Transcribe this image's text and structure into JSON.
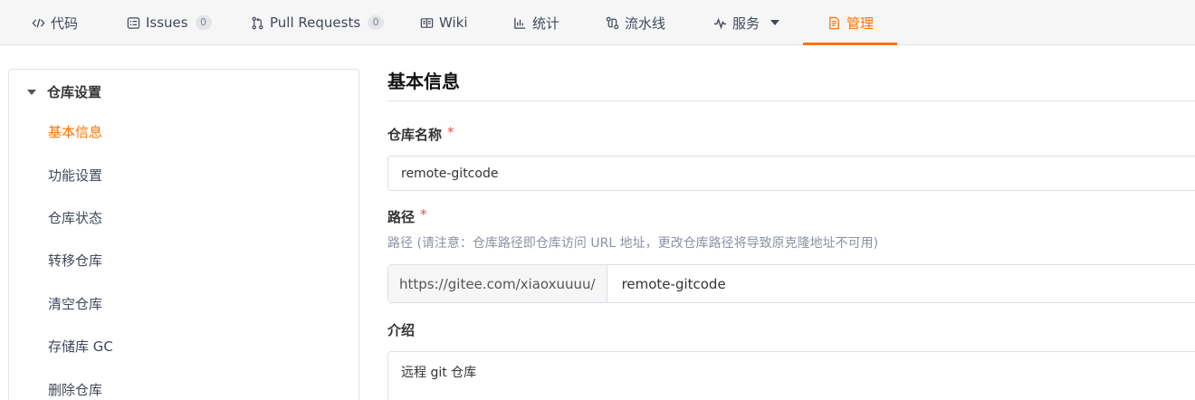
{
  "tabs": [
    {
      "label": "代码",
      "icon": "code-icon"
    },
    {
      "label": "Issues",
      "icon": "issues-icon",
      "count": "0"
    },
    {
      "label": "Pull Requests",
      "icon": "pull-request-icon",
      "count": "0"
    },
    {
      "label": "Wiki",
      "icon": "wiki-icon"
    },
    {
      "label": "统计",
      "icon": "chart-icon"
    },
    {
      "label": "流水线",
      "icon": "pipeline-icon"
    },
    {
      "label": "服务",
      "icon": "pulse-icon"
    },
    {
      "label": "管理",
      "icon": "manage-icon",
      "active": true
    }
  ],
  "sidebar": {
    "group_label": "仓库设置",
    "items": [
      {
        "label": "基本信息",
        "active": true
      },
      {
        "label": "功能设置"
      },
      {
        "label": "仓库状态"
      },
      {
        "label": "转移仓库"
      },
      {
        "label": "清空仓库"
      },
      {
        "label": "存储库 GC"
      },
      {
        "label": "删除仓库"
      }
    ]
  },
  "main": {
    "title": "基本信息",
    "repo_name_label": "仓库名称",
    "repo_name_value": "remote-gitcode",
    "path_label": "路径",
    "path_hint": "路径 (请注意：仓库路径即仓库访问 URL 地址，更改仓库路径将导致原克隆地址不可用)",
    "path_prefix": "https://gitee.com/xiaoxuuuu/",
    "path_value": "remote-gitcode",
    "intro_label": "介绍",
    "intro_value": "远程 git 仓库",
    "required_mark": "*"
  },
  "colors": {
    "accent": "#fe7300",
    "required": "#e44c4c",
    "tab_bg": "#f6f6f7"
  }
}
